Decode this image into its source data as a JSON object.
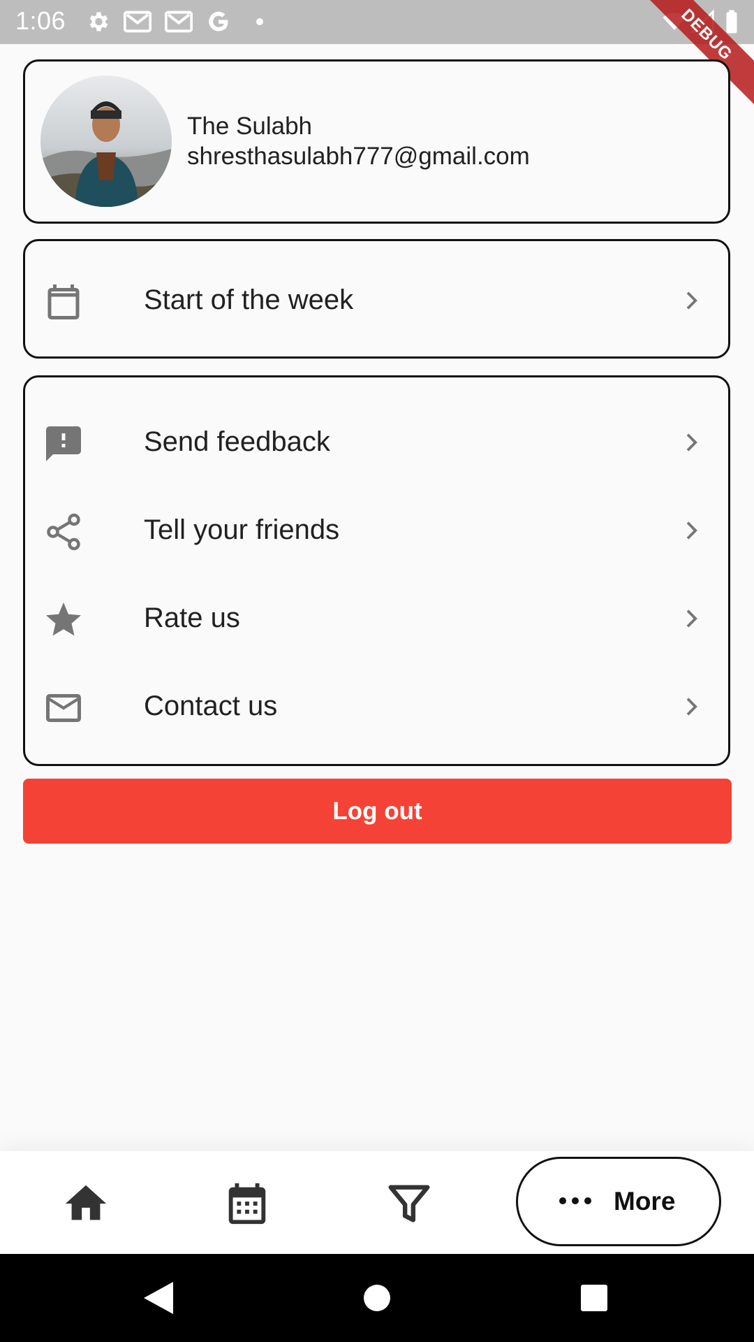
{
  "status_bar": {
    "time": "1:06",
    "icons": [
      "settings-icon",
      "gmail-icon",
      "gmail-icon",
      "google-icon",
      "dot-icon",
      "wifi-icon",
      "signal-icon",
      "battery-icon"
    ],
    "debug_banner": "DEBUG"
  },
  "profile": {
    "name": "The Sulabh",
    "email": "shresthasulabh777@gmail.com"
  },
  "settings": {
    "start_of_week": {
      "label": "Start of the week",
      "icon": "calendar-icon"
    }
  },
  "menu": {
    "items": [
      {
        "label": "Send feedback",
        "icon": "feedback-icon"
      },
      {
        "label": "Tell your friends",
        "icon": "share-icon"
      },
      {
        "label": "Rate us",
        "icon": "star-icon"
      },
      {
        "label": "Contact us",
        "icon": "mail-icon"
      }
    ]
  },
  "logout": {
    "label": "Log out",
    "color": "#f44336"
  },
  "bottom_nav": {
    "items": [
      {
        "icon": "home-icon"
      },
      {
        "icon": "calendar-grid-icon"
      },
      {
        "icon": "filter-icon"
      }
    ],
    "more_label": "More"
  },
  "system_nav": [
    "back-icon",
    "home-circle-icon",
    "recents-icon"
  ]
}
